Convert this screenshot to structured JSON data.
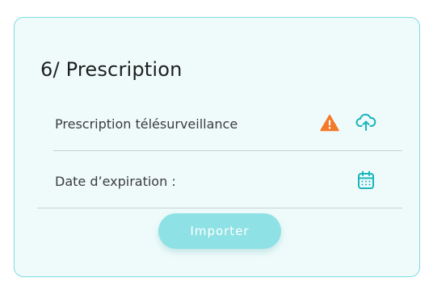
{
  "section": {
    "title": "6/ Prescription"
  },
  "rows": [
    {
      "label": "Prescription télésurveillance",
      "status_icon": "warning-icon",
      "action_icon": "cloud-upload-icon"
    },
    {
      "label": "Date d’expiration :",
      "action_icon": "calendar-icon"
    }
  ],
  "actions": {
    "import_label": "Importer"
  },
  "colors": {
    "card_border": "#7fdbe0",
    "card_background": "#effbfb",
    "accent": "#19b5bd",
    "warning": "#f47a2a",
    "button": "#8ee1e4"
  }
}
